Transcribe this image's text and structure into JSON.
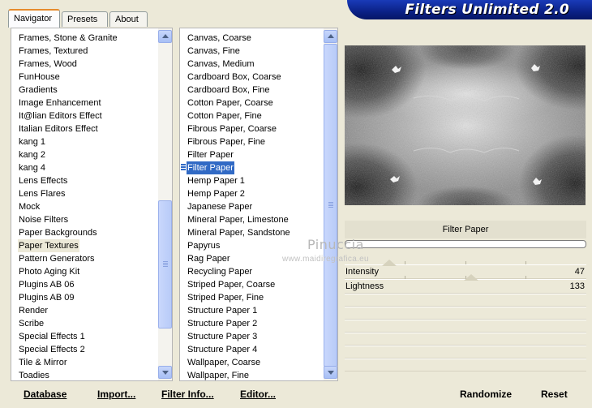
{
  "tabs": [
    {
      "label": "Navigator",
      "active": true
    },
    {
      "label": "Presets",
      "active": false
    },
    {
      "label": "About",
      "active": false
    }
  ],
  "title": "Filters Unlimited 2.0",
  "categories": [
    "Frames, Stone & Granite",
    "Frames, Textured",
    "Frames, Wood",
    "FunHouse",
    "Gradients",
    "Image Enhancement",
    "It@lian Editors Effect",
    "Italian Editors Effect",
    "kang 1",
    "kang 2",
    "kang 4",
    "Lens Effects",
    "Lens Flares",
    "Mock",
    "Noise Filters",
    "Paper Backgrounds",
    "Paper Textures",
    "Pattern Generators",
    "Photo Aging Kit",
    "Plugins AB 06",
    "Plugins AB 09",
    "Render",
    "Scribe",
    "Special Effects 1",
    "Special Effects 2",
    "Tile & Mirror",
    "Toadies"
  ],
  "selected_category": "Paper Textures",
  "filters": [
    "Canvas, Coarse",
    "Canvas, Fine",
    "Canvas, Medium",
    "Cardboard Box, Coarse",
    "Cardboard Box, Fine",
    "Cotton Paper, Coarse",
    "Cotton Paper, Fine",
    "Fibrous Paper, Coarse",
    "Fibrous Paper, Fine",
    "Filter Paper",
    "Filter Paper",
    "Hemp Paper 1",
    "Hemp Paper 2",
    "Japanese Paper",
    "Mineral Paper, Limestone",
    "Mineral Paper, Sandstone",
    "Papyrus",
    "Rag Paper",
    "Recycling Paper",
    "Striped Paper, Coarse",
    "Striped Paper, Fine",
    "Structure Paper 1",
    "Structure Paper 2",
    "Structure Paper 3",
    "Structure Paper 4",
    "Wallpaper, Coarse",
    "Wallpaper, Fine"
  ],
  "selected_filter_index": 10,
  "current_filter": "Filter Paper",
  "sliders": [
    {
      "label": "Intensity",
      "value": "47",
      "fraction": 0.184
    },
    {
      "label": "Lightness",
      "value": "133",
      "fraction": 0.522
    }
  ],
  "watermark": {
    "line1": "Pinuccia",
    "line2": "www.maidiregrafica.eu"
  },
  "buttons": {
    "database": "Database",
    "import": "Import...",
    "filter_info": "Filter Info...",
    "editor": "Editor...",
    "randomize": "Randomize",
    "reset": "Reset"
  },
  "colors": {
    "selection": "#316ac5",
    "banner": "#0b2187",
    "background": "#ece9d8"
  }
}
